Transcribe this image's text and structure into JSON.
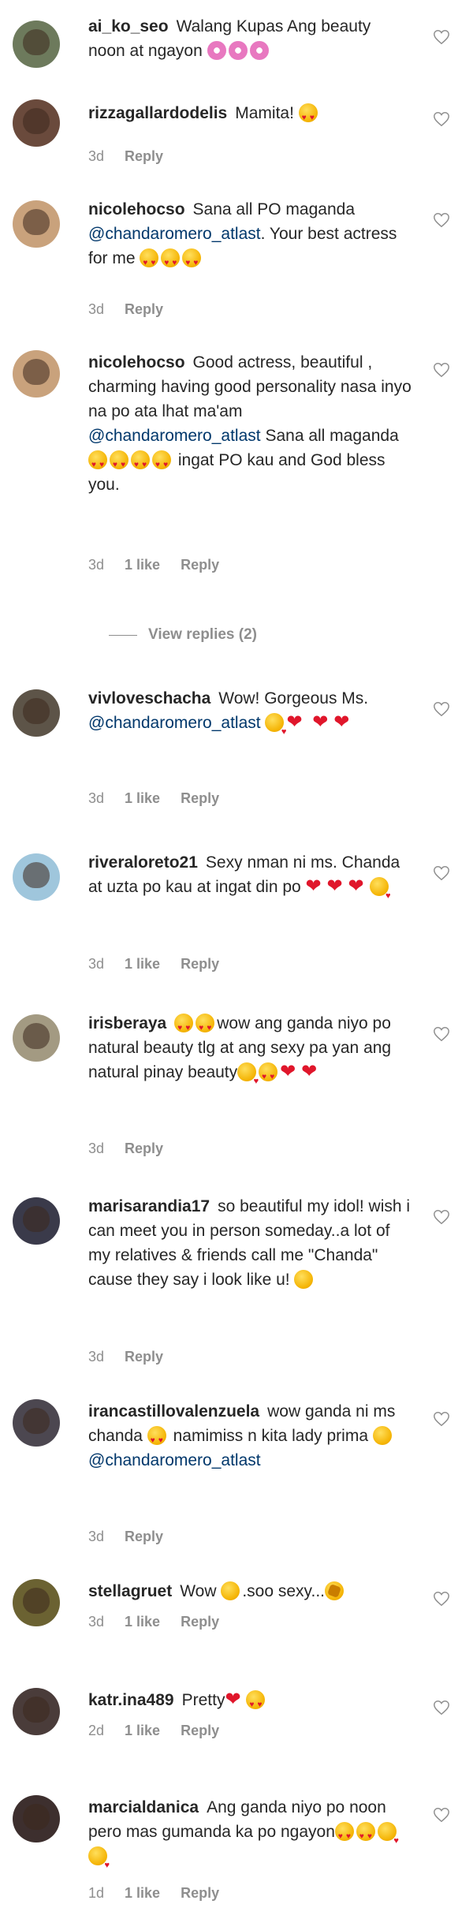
{
  "comments": [
    {
      "username": "ai_ko_seo",
      "lines": [
        "Walang Kupas Ang beauty noon at ngayon"
      ],
      "emojis": [
        "flower",
        "flower",
        "flower"
      ],
      "time": "",
      "likes": "",
      "reply": "",
      "avatar_color": "#6d7a5c"
    },
    {
      "username": "rizzagallardodelis",
      "lines": [
        "Mamita!"
      ],
      "emojis": [
        "heart-eyes"
      ],
      "time": "3d",
      "likes": "",
      "reply": "Reply",
      "avatar_color": "#6a4a3c"
    },
    {
      "username": "nicolehocso",
      "text": "Sana all PO maganda",
      "mention": "@chandaromero_atlast",
      "text_after": ". Your best actress for me",
      "emojis": [
        "heart-eyes",
        "heart-eyes",
        "heart-eyes"
      ],
      "time": "3d",
      "likes": "",
      "reply": "Reply",
      "avatar_color": "#c9a27c"
    },
    {
      "username": "nicolehocso",
      "text": "Good actress, beautiful , charming having good personality nasa inyo na po ata lhat ma'am",
      "mention": "@chandaromero_atlast",
      "text_after": "Sana all maganda",
      "emojis": [
        "heart-eyes",
        "heart-eyes",
        "heart-eyes",
        "heart-eyes"
      ],
      "text_end": "ingat PO kau and God bless you.",
      "time": "3d",
      "likes": "1 like",
      "reply": "Reply",
      "avatar_color": "#c9a27c"
    },
    {
      "username": "vivloveschacha",
      "text": "Wow! Gorgeous Ms.",
      "mention": "@chandaromero_atlast",
      "emojis": [
        "kiss",
        "heart",
        "heart",
        "heart"
      ],
      "time": "3d",
      "likes": "1 like",
      "reply": "Reply",
      "avatar_color": "#5d5448"
    },
    {
      "username": "riveraloreto21",
      "text": "Sexy nman ni ms. Chanda at uzta po kau at ingat din po",
      "emojis": [
        "heart",
        "heart",
        "heart",
        "kiss"
      ],
      "time": "3d",
      "likes": "1 like",
      "reply": "Reply",
      "avatar_color": "#9fc6dc"
    },
    {
      "username": "irisberaya",
      "text": "wow ang ganda niyo po natural beauty tlg at ang sexy pa yan ang natural pinay beauty",
      "lead_emojis": [
        "heart-eyes",
        "heart-eyes"
      ],
      "emojis": [
        "kiss",
        "heart-eyes",
        "heart",
        "heart"
      ],
      "time": "3d",
      "likes": "",
      "reply": "Reply",
      "avatar_color": "#a39a82"
    },
    {
      "username": "marisarandia17",
      "text": "so beautiful my idol! wish i can meet you in person someday..a lot of my relatives & friends call me \"Chanda\" cause they say i look like u!",
      "emojis": [
        "grin"
      ],
      "time": "3d",
      "likes": "",
      "reply": "Reply",
      "avatar_color": "#3a3a4a"
    },
    {
      "username": "irancastillovalenzuela",
      "text": "wow ganda ni ms chanda",
      "emojis_mid": [
        "heart-eyes"
      ],
      "text_after": "namimiss n kita lady prima",
      "emojis": [
        "smile"
      ],
      "mention": "@chandaromero_atlast",
      "time": "3d",
      "likes": "",
      "reply": "Reply",
      "avatar_color": "#4c4750"
    },
    {
      "username": "stellagruet",
      "text": "Wow",
      "emojis_mid": [
        "smile"
      ],
      "text_after": ".soo sexy...",
      "emojis": [
        "clap"
      ],
      "time": "3d",
      "likes": "1 like",
      "reply": "Reply",
      "avatar_color": "#6b6232"
    },
    {
      "username": "katr.ina489",
      "text": "Pretty",
      "emojis": [
        "heart",
        "heart-eyes"
      ],
      "time": "2d",
      "likes": "1 like",
      "reply": "Reply",
      "avatar_color": "#4a3c3a"
    },
    {
      "username": "marcialdanica",
      "text": "Ang ganda niyo po noon pero mas gumanda ka po ngayon",
      "emojis": [
        "heart-eyes",
        "heart-eyes",
        "kiss",
        "kiss"
      ],
      "time": "1d",
      "likes": "1 like",
      "reply": "Reply",
      "avatar_color": "#3d2f2e"
    }
  ],
  "view_replies_label": "View replies (2)"
}
